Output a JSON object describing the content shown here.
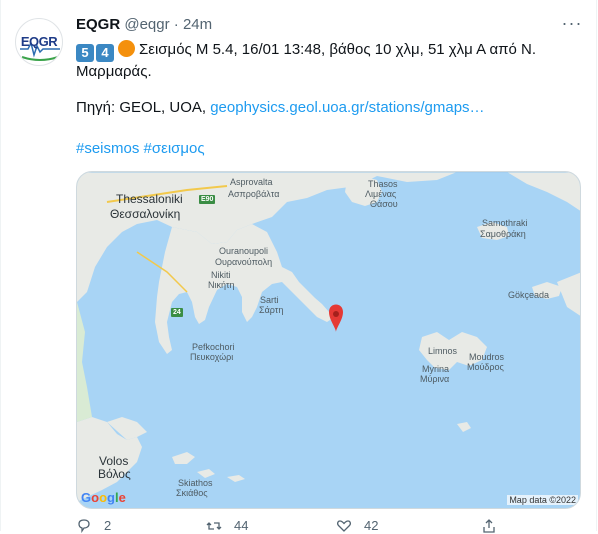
{
  "tweet": {
    "author_name": "EQGR",
    "handle": "@eqgr",
    "separator": "·",
    "time": "24m",
    "avatar_text": "EQGR",
    "keycap_1": "5",
    "keycap_2": "4",
    "line1": "Σεισμός M 5.4, 16/01 13:48, βάθος 10 χλμ, 51 χλμ Α από Ν.",
    "line2": "Μαρμαράς.",
    "source_prefix": "Πηγή: GEOL, UOA, ",
    "source_link": "geophysics.geol.uoa.gr/stations/gmaps…",
    "hashtag_1": "#seismos",
    "hashtag_2": "#σεισμος"
  },
  "map": {
    "labels": {
      "thessaloniki_en": "Thessaloniki",
      "thessaloniki_gr": "Θεσσαλονίκη",
      "asprovalta_en": "Asprovalta",
      "asprovalta_gr": "Ασπροβάλτα",
      "thasos_en": "Thasos",
      "thasos_gr": "Λιμένας",
      "thasos_gr2": "Θάσου",
      "samothraki_en": "Samothraki",
      "samothraki_gr": "Σαμοθράκη",
      "ouranoupoli_en": "Ouranoupoli",
      "ouranoupoli_gr": "Ουρανούπολη",
      "nikiti_en": "Nikiti",
      "nikiti_gr": "Νικήτη",
      "sarti_en": "Sarti",
      "sarti_gr": "Σάρτη",
      "gokceada": "Gökçeada",
      "pefkochori_en": "Pefkochori",
      "pefkochori_gr": "Πευκοχώρι",
      "limnos_en": "Limnos",
      "moudros_en": "Moudros",
      "moudros_gr": "Μούδρος",
      "myrina_en": "Myrina",
      "myrina_gr": "Μύρινα",
      "volos_en": "Volos",
      "volos_gr": "Βόλος",
      "skiathos_en": "Skiathos",
      "skiathos_gr": "Σκιάθος",
      "road_e90": "E90",
      "road_24": "24"
    },
    "google_logo": "Google",
    "attribution": "Map data ©2022",
    "marker_color": "#e53935"
  },
  "actions": {
    "reply_count": "2",
    "retweet_count": "44",
    "like_count": "42"
  },
  "colors": {
    "link": "#1d9bf0",
    "sea": "#a8d4f5",
    "land": "#e8eae6"
  }
}
